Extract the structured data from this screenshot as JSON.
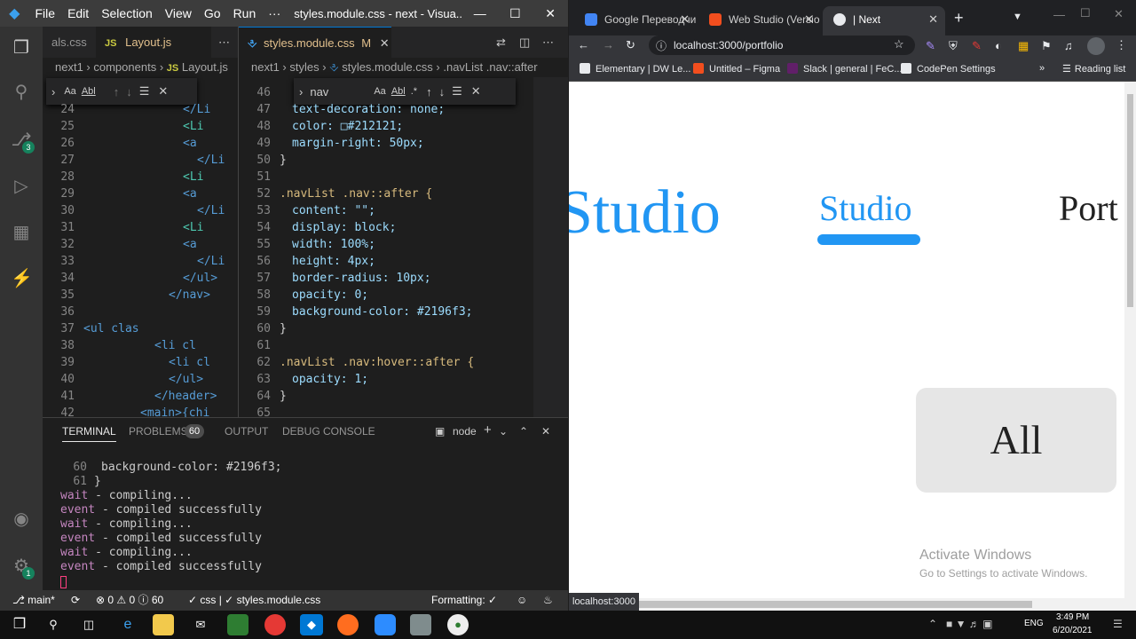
{
  "vscode": {
    "menu": [
      "File",
      "Edit",
      "Selection",
      "View",
      "Go",
      "Run",
      "···"
    ],
    "window_title": "styles.module.css - next - Visua...",
    "activity": {
      "source_control_badge": "3",
      "settings_badge": "1"
    },
    "left_pane": {
      "tab_partial": "als.css",
      "tab_layout": "Layout.js",
      "tab_layout_icon": "JS",
      "breadcrumb": [
        "next1",
        "components",
        "JS",
        "Layout.js"
      ],
      "find_controls": [
        "Aa",
        "Abl"
      ],
      "lines": [
        {
          "n": "24",
          "t": "</Li"
        },
        {
          "n": "25",
          "t": "<Li"
        },
        {
          "n": "26",
          "t": "<a"
        },
        {
          "n": "27",
          "t": "</Li"
        },
        {
          "n": "28",
          "t": "<Li"
        },
        {
          "n": "29",
          "t": "<a"
        },
        {
          "n": "30",
          "t": "</Li"
        },
        {
          "n": "31",
          "t": "<Li"
        },
        {
          "n": "32",
          "t": "<a"
        },
        {
          "n": "33",
          "t": "</Li"
        },
        {
          "n": "34",
          "t": "</ul>"
        },
        {
          "n": "35",
          "t": "</nav>"
        },
        {
          "n": "36",
          "t": ""
        },
        {
          "n": "37",
          "t": "<ul clas"
        },
        {
          "n": "38",
          "t": "<li cl"
        },
        {
          "n": "39",
          "t": "<li cl"
        },
        {
          "n": "40",
          "t": "</ul>"
        },
        {
          "n": "41",
          "t": "</header>"
        },
        {
          "n": "42",
          "t": "<main>{chi"
        }
      ]
    },
    "right_pane": {
      "tab": "styles.module.css",
      "tab_status": "M",
      "breadcrumb": [
        "next1",
        "styles",
        "styles.module.css",
        ".navList .nav::after"
      ],
      "find_query": "nav",
      "find_controls": [
        "Aa",
        "Abl",
        ".*"
      ],
      "lines": [
        {
          "n": "46",
          "t": "text-decoration: none;"
        },
        {
          "n": "47",
          "t": "text-decoration: none;"
        },
        {
          "n": "48",
          "t": "color: □#212121;"
        },
        {
          "n": "49",
          "t": "margin-right: 50px;"
        },
        {
          "n": "50",
          "t": "}"
        },
        {
          "n": "51",
          "t": ""
        },
        {
          "n": "52",
          "t": ".navList .nav::after {"
        },
        {
          "n": "53",
          "t": "content: \"\";"
        },
        {
          "n": "54",
          "t": "display: block;"
        },
        {
          "n": "55",
          "t": "width: 100%;"
        },
        {
          "n": "56",
          "t": "height: 4px;"
        },
        {
          "n": "57",
          "t": "border-radius: 10px;"
        },
        {
          "n": "58",
          "t": "opacity: 0;"
        },
        {
          "n": "59",
          "t": "background-color: #2196f3;"
        },
        {
          "n": "60",
          "t": "}"
        },
        {
          "n": "61",
          "t": ""
        },
        {
          "n": "62",
          "t": ".navList .nav:hover::after {"
        },
        {
          "n": "63",
          "t": "opacity: 1;"
        },
        {
          "n": "64",
          "t": "}"
        },
        {
          "n": "65",
          "t": ""
        }
      ]
    },
    "panel": {
      "tabs": [
        "TERMINAL",
        "PROBLEMS",
        "OUTPUT",
        "DEBUG CONSOLE"
      ],
      "problems_count": "60",
      "shell": "node",
      "lines": [
        {
          "a": "60",
          "b": "background-color: #2196f3;"
        },
        {
          "a": "61",
          "b": "}"
        },
        {
          "a": "wait",
          "b": " - compiling..."
        },
        {
          "a": "event",
          "b": " - compiled successfully"
        },
        {
          "a": "wait",
          "b": " - compiling..."
        },
        {
          "a": "event",
          "b": " - compiled successfully"
        },
        {
          "a": "wait",
          "b": " - compiling..."
        },
        {
          "a": "event",
          "b": " - compiled successfully"
        }
      ]
    },
    "status": {
      "branch": "main*",
      "errors": "0",
      "warnings": "0",
      "info": "60",
      "css": "css",
      "file": "styles.module.css",
      "formatting": "Formatting: ✓"
    }
  },
  "chrome": {
    "tabs": [
      "Google Переводчик",
      "Web Studio (Versio",
      "| Next"
    ],
    "url": "localhost:3000/portfolio",
    "bookmarks": [
      "Elementary | DW Le...",
      "Untitled – Figma",
      "Slack | general | FeC...",
      "CodePen Settings"
    ],
    "reading_list": "Reading list",
    "status_url": "localhost:3000",
    "page": {
      "logo_fragment": "Studio",
      "nav_active": "Studio",
      "nav_next": "Port",
      "filter_button": "All",
      "watermark_title": "Activate Windows",
      "watermark_sub": "Go to Settings to activate Windows."
    }
  },
  "taskbar": {
    "time": "3:49 PM",
    "date": "6/20/2021",
    "lang": "ENG"
  }
}
